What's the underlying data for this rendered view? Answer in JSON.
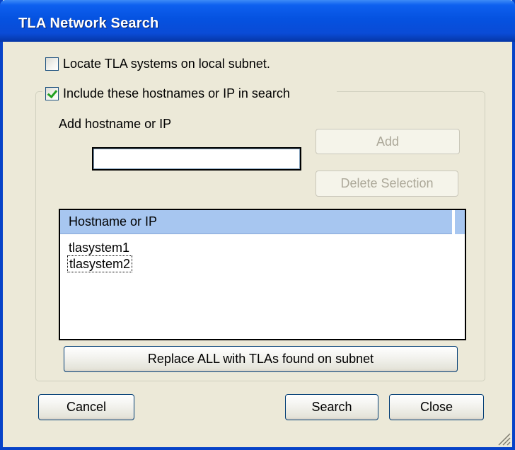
{
  "window": {
    "title": "TLA Network Search"
  },
  "options": {
    "locate_local": {
      "label": "Locate TLA systems on local subnet.",
      "checked": false
    },
    "include_hosts": {
      "label": "Include these hostnames or IP in search",
      "checked": true
    }
  },
  "host_input": {
    "label": "Add hostname or IP",
    "value": ""
  },
  "buttons": {
    "add": "Add",
    "delete_selection": "Delete Selection",
    "replace_all": "Replace ALL with TLAs found on subnet",
    "cancel": "Cancel",
    "search": "Search",
    "close": "Close"
  },
  "host_list": {
    "column_header": "Hostname or IP",
    "items": [
      "tlasystem1",
      "tlasystem2"
    ]
  },
  "colors": {
    "titlebar": "#0552e0",
    "dialog_background": "#ece9d8",
    "list_header": "#a7c6f0",
    "check_mark": "#21a121"
  }
}
